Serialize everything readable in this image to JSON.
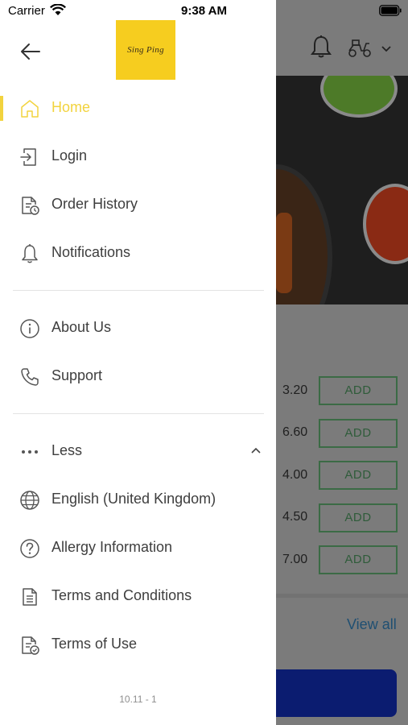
{
  "status_bar": {
    "carrier": "Carrier",
    "time": "9:38 AM"
  },
  "brand": {
    "logo_text": "Sing Ping",
    "logo_color": "#F6CD1F",
    "accent": "#F2D33E"
  },
  "menu": {
    "primary": [
      {
        "label": "Home",
        "icon": "home-icon",
        "active": true
      },
      {
        "label": "Login",
        "icon": "login-icon",
        "active": false
      },
      {
        "label": "Order History",
        "icon": "order-history-icon",
        "active": false
      },
      {
        "label": "Notifications",
        "icon": "bell-icon",
        "active": false
      }
    ],
    "secondary": [
      {
        "label": "About Us",
        "icon": "info-icon"
      },
      {
        "label": "Support",
        "icon": "phone-icon"
      }
    ],
    "more_toggle": {
      "label": "Less",
      "icon": "ellipsis-icon",
      "expanded": true
    },
    "extra": [
      {
        "label": "English (United Kingdom)",
        "icon": "globe-icon"
      },
      {
        "label": "Allergy Information",
        "icon": "question-icon"
      },
      {
        "label": "Terms and Conditions",
        "icon": "document-icon"
      },
      {
        "label": "Terms of Use",
        "icon": "document-check-icon"
      }
    ]
  },
  "version": "10.11 - 1",
  "background": {
    "prices": [
      "3.20",
      "6.60",
      "4.00",
      "4.50",
      "7.00"
    ],
    "add_label": "ADD",
    "view_all": "View all"
  }
}
